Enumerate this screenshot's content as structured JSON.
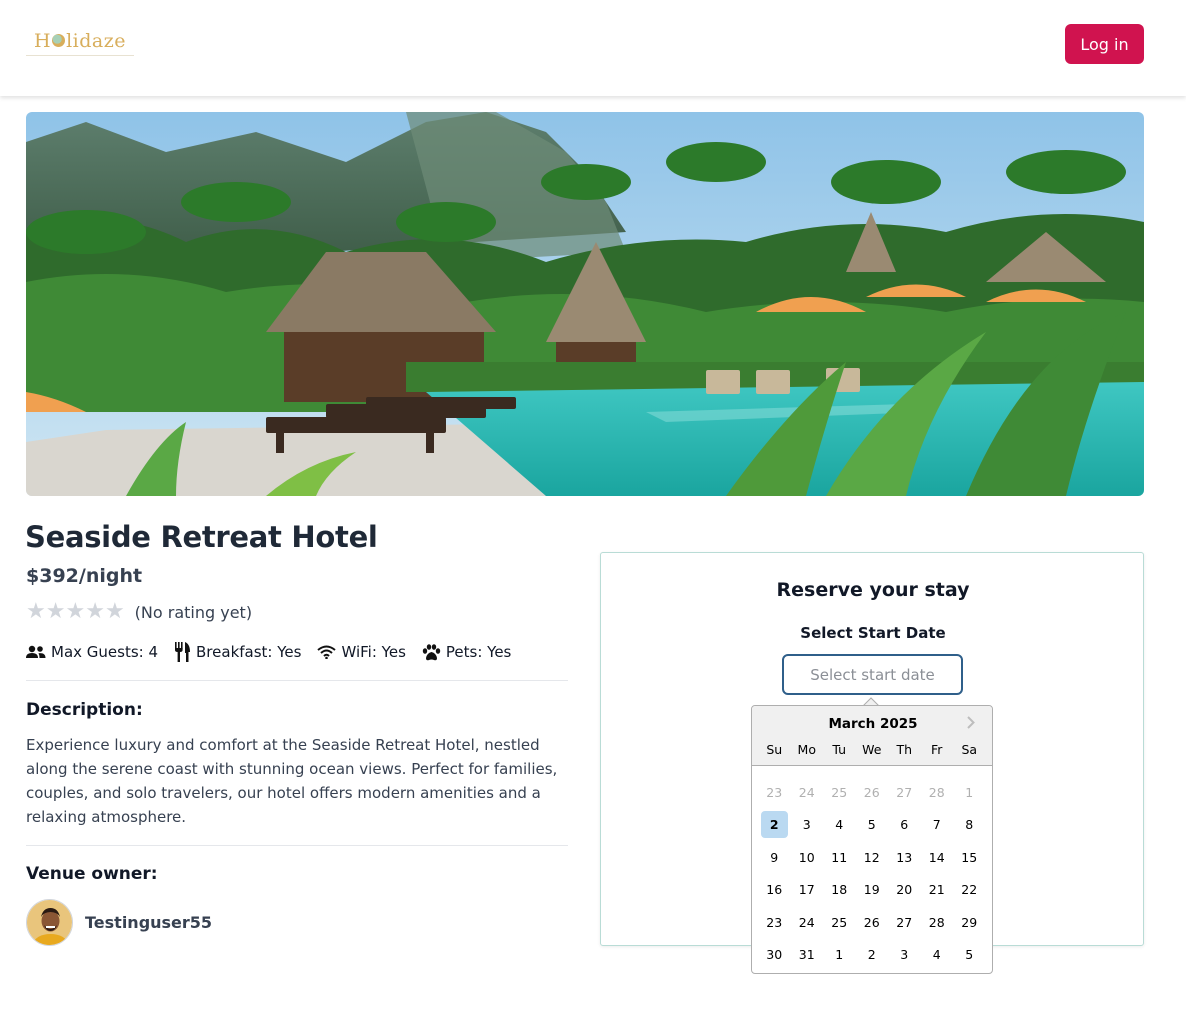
{
  "header": {
    "logo_text_pre": "H",
    "logo_text_post": "lidaze",
    "login_label": "Log in"
  },
  "venue": {
    "name": "Seaside Retreat Hotel",
    "price": "$392/night",
    "rating_stars": 0,
    "rating_max": 5,
    "rating_text": "(No rating yet)",
    "amenities": {
      "max_guests": "Max Guests: 4",
      "breakfast": "Breakfast: Yes",
      "wifi": "WiFi: Yes",
      "pets": "Pets: Yes"
    },
    "description_label": "Description:",
    "description": "Experience luxury and comfort at the Seaside Retreat Hotel, nestled along the serene coast with stunning ocean views. Perfect for families, couples, and solo travelers, our hotel offers modern amenities and a relaxing atmosphere.",
    "owner_label": "Venue owner:",
    "owner_name": "Testinguser55"
  },
  "reserve": {
    "title": "Reserve your stay",
    "start_label": "Select Start Date",
    "start_placeholder": "Select start date"
  },
  "calendar": {
    "month": "March 2025",
    "weekdays": [
      "Su",
      "Mo",
      "Tu",
      "We",
      "Th",
      "Fr",
      "Sa"
    ],
    "weeks": [
      [
        "23",
        "24",
        "25",
        "26",
        "27",
        "28",
        "1"
      ],
      [
        "2",
        "3",
        "4",
        "5",
        "6",
        "7",
        "8"
      ],
      [
        "9",
        "10",
        "11",
        "12",
        "13",
        "14",
        "15"
      ],
      [
        "16",
        "17",
        "18",
        "19",
        "20",
        "21",
        "22"
      ],
      [
        "23",
        "24",
        "25",
        "26",
        "27",
        "28",
        "29"
      ],
      [
        "30",
        "31",
        "1",
        "2",
        "3",
        "4",
        "5"
      ]
    ],
    "muted_cells": [
      [
        0,
        0
      ],
      [
        0,
        1
      ],
      [
        0,
        2
      ],
      [
        0,
        3
      ],
      [
        0,
        4
      ],
      [
        0,
        5
      ],
      [
        0,
        6
      ]
    ],
    "selected_cell": [
      1,
      0
    ]
  },
  "colors": {
    "brand": "#d0134f",
    "logo": "#d8ae5c",
    "selected_day": "#bad9f1"
  }
}
